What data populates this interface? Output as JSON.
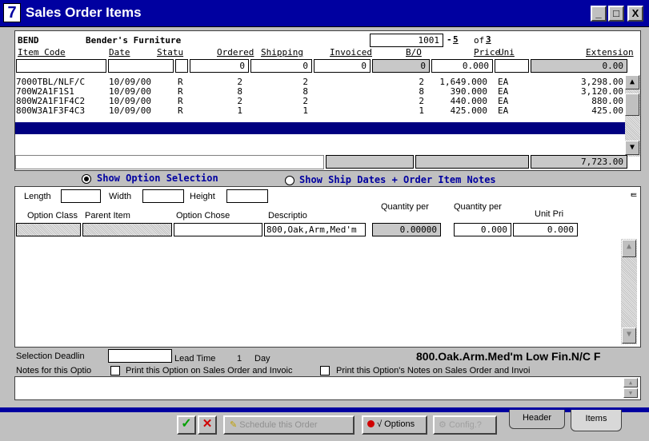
{
  "window": {
    "title": "Sales Order Items",
    "icon_glyph": "7",
    "min_glyph": "_",
    "max_glyph": "□",
    "close_glyph": "X"
  },
  "customer": {
    "code": "BEND",
    "name": "Bender's Furniture"
  },
  "order": {
    "number": "1001",
    "dash": "-",
    "line": "5",
    "of_label": "of",
    "total": "3"
  },
  "columns": [
    "Item Code",
    "Date",
    "Statu",
    "Ordered",
    "Shipping",
    "Invoiced",
    "B/O",
    "Price",
    "Uni",
    "Extension"
  ],
  "entry": {
    "item_code": "",
    "date": "",
    "status": "",
    "ordered": "0",
    "shipping": "0",
    "invoiced": "0",
    "bo": "0",
    "price": "0.000",
    "unit": "",
    "extension": "0.00"
  },
  "rows": [
    {
      "item": "7000TBL/NLF/C",
      "date": "10/09/00",
      "status": "R",
      "ordered": "2",
      "shipping": "2",
      "bo": "2",
      "price": "1,649.000",
      "unit": "EA",
      "ext": "3,298.00"
    },
    {
      "item": "700W2A1F1S1",
      "date": "10/09/00",
      "status": "R",
      "ordered": "8",
      "shipping": "8",
      "bo": "8",
      "price": "390.000",
      "unit": "EA",
      "ext": "3,120.00"
    },
    {
      "item": "800W2A1F1F4C2",
      "date": "10/09/00",
      "status": "R",
      "ordered": "2",
      "shipping": "2",
      "bo": "2",
      "price": "440.000",
      "unit": "EA",
      "ext": "880.00"
    },
    {
      "item": "800W3A1F3F4C3",
      "date": "10/09/00",
      "status": "R",
      "ordered": "1",
      "shipping": "1",
      "bo": "1",
      "price": "425.000",
      "unit": "EA",
      "ext": "425.00"
    }
  ],
  "total_extension": "7,723.00",
  "radio": {
    "option_selection": "Show Option Selection",
    "ship_dates": "Show Ship Dates + Order Item Notes",
    "selected": "option_selection"
  },
  "dims": {
    "length_label": "Length",
    "width_label": "Width",
    "height_label": "Height",
    "length": "",
    "width": "",
    "height": ""
  },
  "options_header": {
    "option_class": "Option Class",
    "parent_item": "Parent Item",
    "option_chose": "Option Chose",
    "descriptio": "Descriptio",
    "qty_per1": "Quantity per",
    "qty_per2": "Quantity per",
    "unit_pri": "Unit Pri",
    "corner_glyph": "ᄐ"
  },
  "option_row": {
    "option_class": "",
    "parent_item": "",
    "option_chose": "",
    "description": "800,Oak,Arm,Med'm",
    "qty1": "0.00000",
    "qty2": "0.000",
    "unit_price": "0.000"
  },
  "footer": {
    "selection_deadline_label": "Selection Deadlin",
    "selection_deadline": "",
    "lead_time_label": "Lead Time",
    "lead_time_value": "1",
    "lead_time_unit": "Day",
    "description_long": "800.Oak.Arm.Med'm Low Fin.N/C F",
    "notes_label": "Notes for this Optio",
    "print_option": "Print this Option on Sales Order and Invoic",
    "print_notes": "Print this Option's Notes on Sales Order and Invoi",
    "notes_text": ""
  },
  "toolbar": {
    "ok_glyph": "✓",
    "cancel_glyph": "✕",
    "schedule": "Schedule this Order",
    "options": "√ Options",
    "config": "Config.?"
  },
  "tabs": {
    "header": "Header",
    "items": "Items"
  },
  "colors": {
    "title_bg": "#0000a0",
    "selected_row": "#000080",
    "window_bg": "#c0c0c0"
  }
}
